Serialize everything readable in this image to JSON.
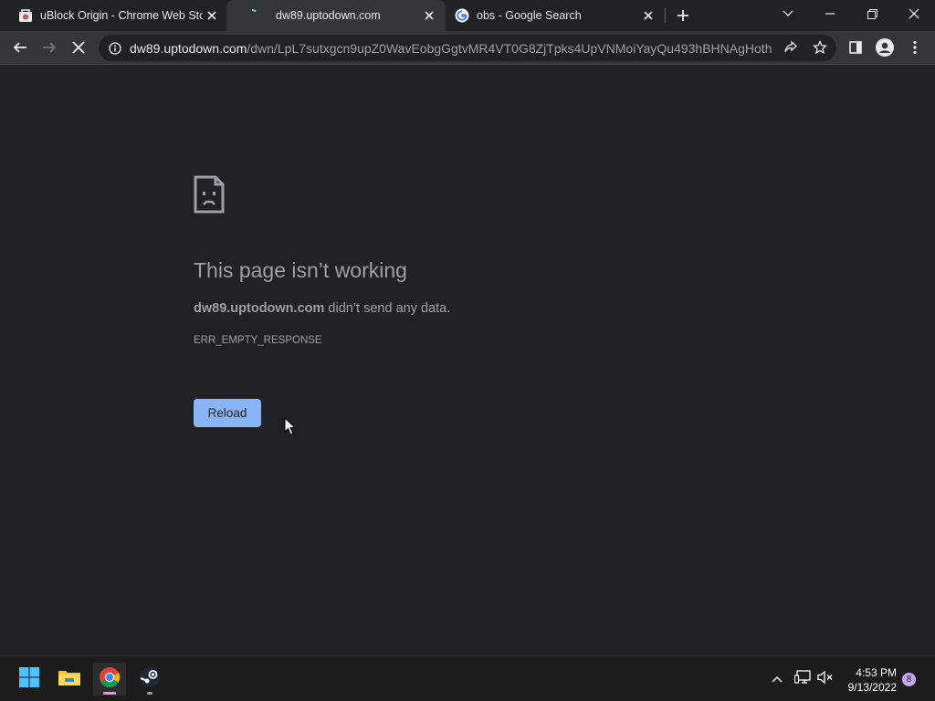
{
  "tabs": [
    {
      "title": "uBlock Origin - Chrome Web Store",
      "favicon": "chrome-web-store-icon",
      "active": false
    },
    {
      "title": "dw89.uptodown.com",
      "favicon": "loading-spinner-icon",
      "active": true
    },
    {
      "title": "obs - Google Search",
      "favicon": "google-icon",
      "active": false
    }
  ],
  "toolbar": {
    "url_host": "dw89.uptodown.com",
    "url_path": "/dwn/LpL7sutxgcn9upZ0WavEobgGgtvMR4VT0G8ZjTpks4UpVNMoiYayQu493hBHNAgHoth..."
  },
  "error_page": {
    "heading": "This page isn’t working",
    "host": "dw89.uptodown.com",
    "message": " didn’t send any data.",
    "error_code": "ERR_EMPTY_RESPONSE",
    "reload_label": "Reload"
  },
  "taskbar": {
    "apps": [
      "start-icon",
      "file-explorer-icon",
      "chrome-icon",
      "steam-icon"
    ],
    "time": "4:53 PM",
    "date": "9/13/2022",
    "notification_count": "8"
  },
  "colors": {
    "page_bg": "#202124",
    "toolbar_bg": "#35363a",
    "accent": "#8ab4f8",
    "text_dim": "#9aa0a6",
    "taskbar_bg": "#1c1c1c"
  }
}
